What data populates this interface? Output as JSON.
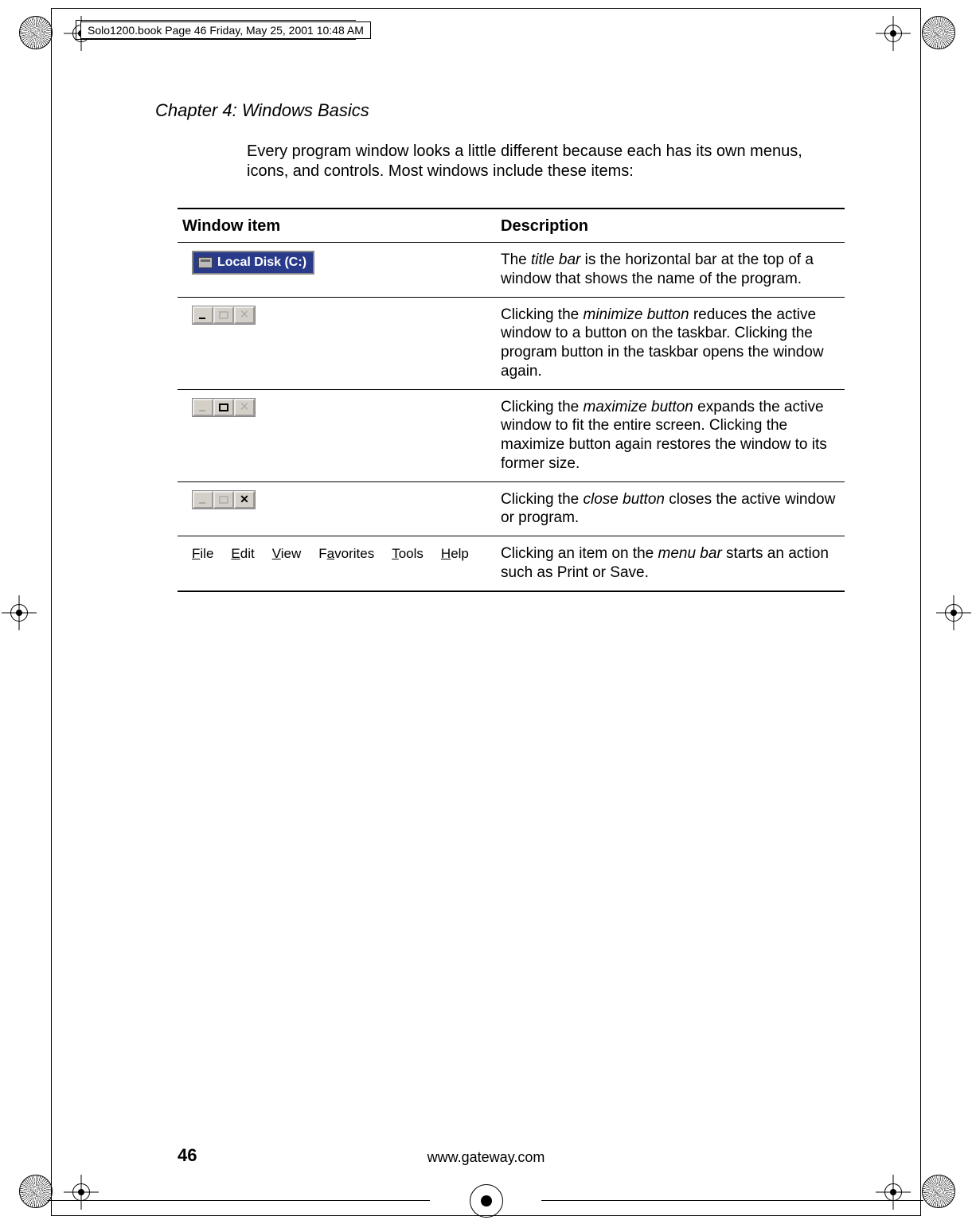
{
  "header": {
    "running_head": "Solo1200.book  Page 46  Friday, May 25, 2001  10:48 AM"
  },
  "chapter": "Chapter 4: Windows Basics",
  "intro": "Every program window looks a little different because each has its own menus, icons, and controls. Most windows include these items:",
  "table": {
    "col1": "Window item",
    "col2": "Description",
    "rows": [
      {
        "icon_label": "Local Disk (C:)",
        "desc_pre": "The ",
        "desc_em": "title bar",
        "desc_post": " is the horizontal bar at the top of a window that shows the name of the program."
      },
      {
        "desc_pre": "Clicking the ",
        "desc_em": "minimize button",
        "desc_post": " reduces the active window to a button on the taskbar. Clicking the program button in the taskbar opens the window again."
      },
      {
        "desc_pre": "Clicking the ",
        "desc_em": "maximize button",
        "desc_post": " expands the active window to fit the entire screen. Clicking the maximize button again restores the window to its former size."
      },
      {
        "desc_pre": "Clicking the ",
        "desc_em": "close button",
        "desc_post": " closes the active window or program."
      },
      {
        "menu": {
          "file": "File",
          "edit": "Edit",
          "view": "View",
          "favorites": "Favorites",
          "tools": "Tools",
          "help": "Help"
        },
        "desc_pre": "Clicking an item on the ",
        "desc_em": "menu bar",
        "desc_post": " starts an action such as Print or Save."
      }
    ]
  },
  "footer": {
    "page_number": "46",
    "url": "www.gateway.com"
  }
}
